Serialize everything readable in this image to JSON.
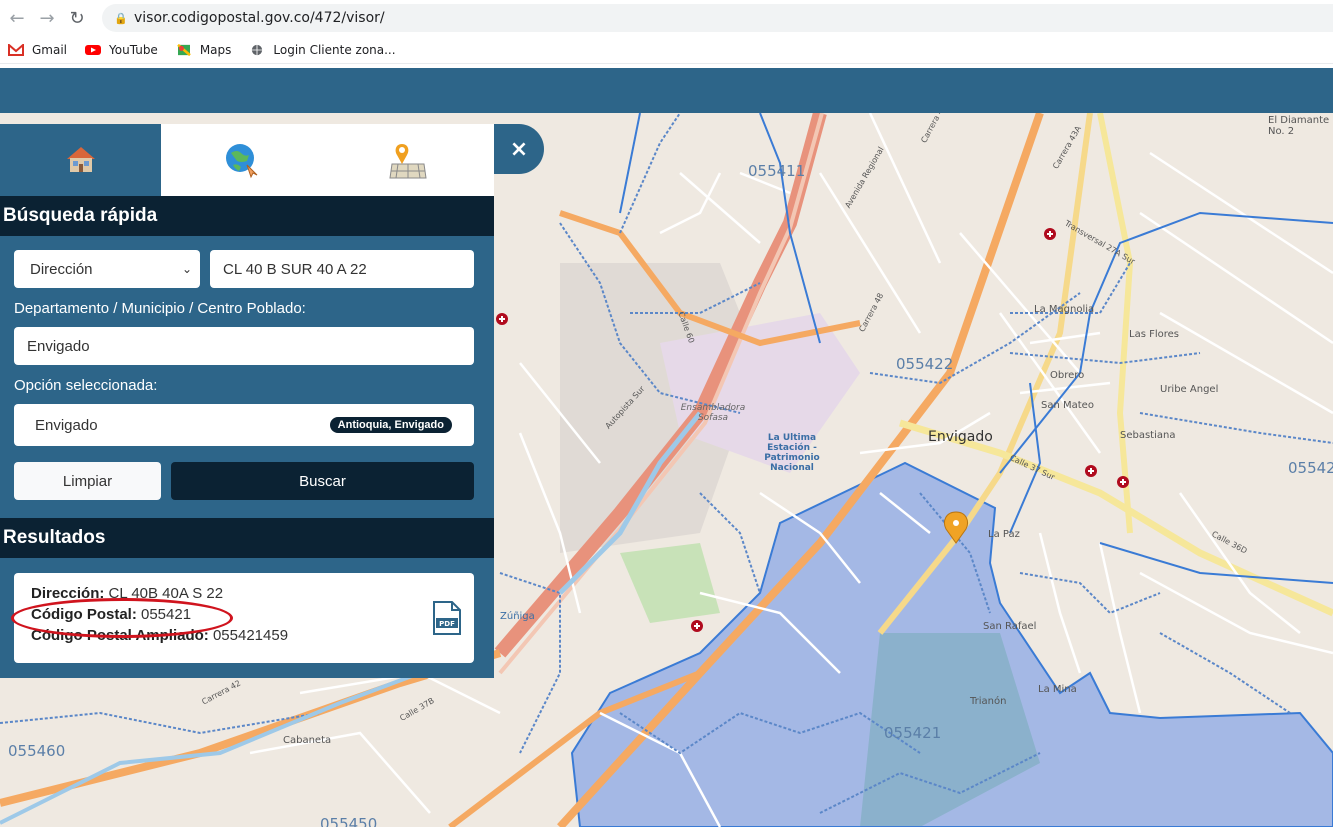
{
  "browser": {
    "url": "visor.codigopostal.gov.co/472/visor/",
    "bookmarks": [
      {
        "label": "Gmail",
        "icon": "gmail-icon"
      },
      {
        "label": "YouTube",
        "icon": "youtube-icon"
      },
      {
        "label": "Maps",
        "icon": "maps-icon"
      },
      {
        "label": "Login Cliente zona...",
        "icon": "globe-icon"
      }
    ]
  },
  "panel": {
    "tabs": [
      {
        "icon": "house-icon"
      },
      {
        "icon": "globe-pointer-icon"
      },
      {
        "icon": "map-pin-grid-icon"
      }
    ],
    "quick_search_title": "Búsqueda rápida",
    "search_type": "Dirección",
    "address_value": "CL 40 B SUR 40 A 22",
    "dept_label": "Departamento / Municipio / Centro Poblado:",
    "dept_value": "Envigado",
    "selected_label": "Opción seleccionada:",
    "selected_value": "Envigado",
    "selected_badge": "Antioquia, Envigado",
    "clear_label": "Limpiar",
    "search_label": "Buscar",
    "results_title": "Resultados",
    "result": {
      "address_label": "Dirección:",
      "address_value": "CL 40B 40A S 22",
      "postal_label": "Código Postal:",
      "postal_value": "055421",
      "extended_label": "Código Postal Ampliado:",
      "extended_value": "055421459"
    },
    "close_label": "×"
  },
  "map": {
    "zones": [
      "055411",
      "055422",
      "055421",
      "055460",
      "05542",
      "055450"
    ],
    "places": [
      "Envigado",
      "Ensambladora Sofasa",
      "La Ultima Estación - Patrimonio Nacional",
      "La Magnolia",
      "Las Flores",
      "Uribe Angel",
      "Obrero",
      "San Mateo",
      "Sebastiana",
      "La Paz",
      "San Rafael",
      "Trianón",
      "La Mina",
      "El Diamante No. 2",
      "Zúñiga",
      "Cabaneta"
    ],
    "streets": [
      "Autopista Sur",
      "Avenida Regional",
      "Carrera 48",
      "Carrera 43A",
      "Carrera 42",
      "Calle 37B",
      "Calle 36D",
      "Calle 37 Sur",
      "Transversal 27A Sur",
      "Carrera 49",
      "Calle 60"
    ],
    "colors": {
      "zone_fill": "#7b9ee6",
      "road_major": "#f5a962",
      "road_trunk": "#e8927c",
      "boundary": "#3a7bd5"
    }
  }
}
